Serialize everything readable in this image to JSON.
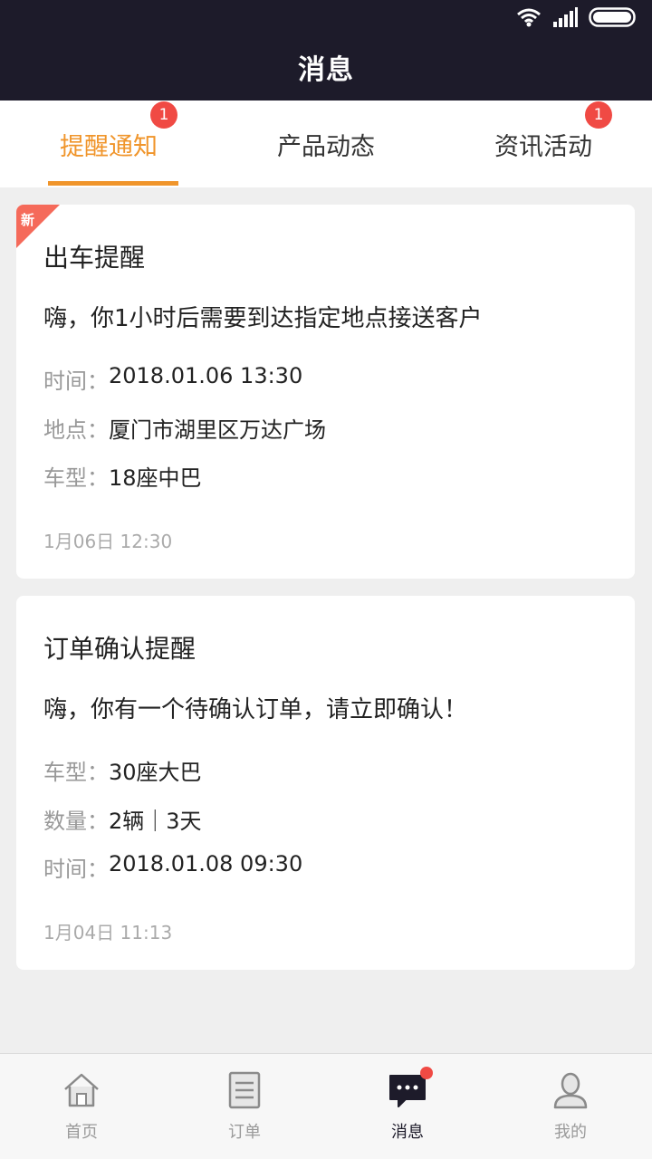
{
  "header": {
    "title": "消息"
  },
  "tabs": [
    {
      "label": "提醒通知",
      "badge": "1",
      "active": true
    },
    {
      "label": "产品动态",
      "badge": "",
      "active": false
    },
    {
      "label": "资讯活动",
      "badge": "1",
      "active": false
    }
  ],
  "cards": [
    {
      "new_tag": "新",
      "title": "出车提醒",
      "message": "嗨，你1小时后需要到达指定地点接送客户",
      "rows": [
        {
          "key": "时间：",
          "value": "2018.01.06 13:30"
        },
        {
          "key": "地点：",
          "value": "厦门市湖里区万达广场"
        },
        {
          "key": "车型：",
          "value": "18座中巴"
        }
      ],
      "time": "1月06日 12:30"
    },
    {
      "title": "订单确认提醒",
      "message": "嗨，你有一个待确认订单，请立即确认！",
      "rows": [
        {
          "key": "车型：",
          "value": "30座大巴"
        },
        {
          "key": "数量：",
          "value": "2辆｜3天"
        },
        {
          "key": "时间：",
          "value": "2018.01.08 09:30"
        }
      ],
      "time": "1月04日 11:13"
    }
  ],
  "bottom_nav": [
    {
      "label": "首页",
      "icon": "home-icon",
      "active": false
    },
    {
      "label": "订单",
      "icon": "order-icon",
      "active": false
    },
    {
      "label": "消息",
      "icon": "message-icon",
      "active": true
    },
    {
      "label": "我的",
      "icon": "profile-icon",
      "active": false
    }
  ],
  "colors": {
    "accent": "#f0952b",
    "header_bg": "#1d1b2a",
    "badge": "#f04a44"
  }
}
